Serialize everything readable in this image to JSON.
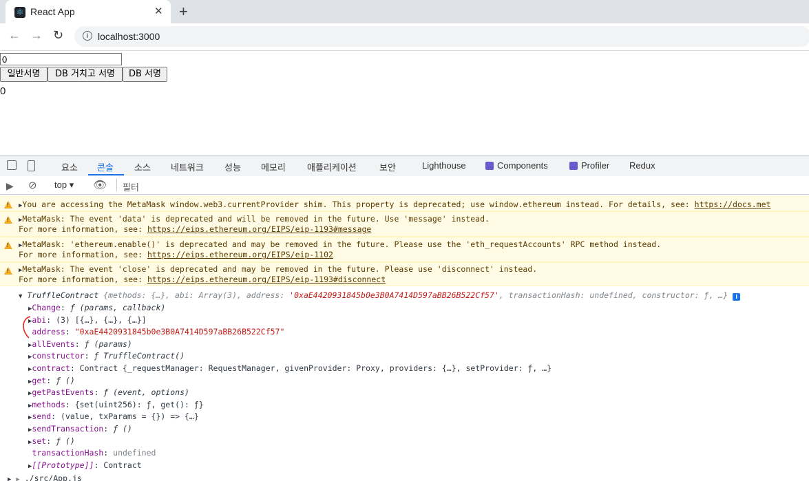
{
  "browser": {
    "tab_title": "React App",
    "url": "localhost:3000"
  },
  "page": {
    "input_value": "0",
    "buttons": [
      "일반서명",
      "DB 거치고 서명",
      "DB 서명"
    ],
    "output": "0"
  },
  "devtools": {
    "tabs": [
      "요소",
      "콘솔",
      "소스",
      "네트워크",
      "성능",
      "메모리",
      "애플리케이션",
      "보안",
      "Lighthouse",
      "Components",
      "Profiler",
      "Redux"
    ],
    "active_tab": "콘솔",
    "context": "top",
    "filter_placeholder": "필터"
  },
  "console": {
    "warnings": [
      {
        "text": "You are accessing the MetaMask window.web3.currentProvider shim. This property is deprecated; use window.ethereum instead. For details, see: ",
        "link": "https://docs.met"
      },
      {
        "text": "MetaMask: The event 'data' is deprecated and will be removed in the future. Use 'message' instead.",
        "more": "For more information, see: ",
        "link": "https://eips.ethereum.org/EIPS/eip-1193#message"
      },
      {
        "text": "MetaMask: 'ethereum.enable()' is deprecated and may be removed in the future. Please use the 'eth_requestAccounts' RPC method instead.",
        "more": "For more information, see: ",
        "link": "https://eips.ethereum.org/EIPS/eip-1102"
      },
      {
        "text": "MetaMask: The event 'close' is deprecated and may be removed in the future. Please use 'disconnect' instead.",
        "more": "For more information, see: ",
        "link": "https://eips.ethereum.org/EIPS/eip-1193#disconnect"
      }
    ],
    "object_header": {
      "name": "TruffleContract",
      "summary_a": " {methods: {…}, abi: Array(3), address: ",
      "address": "'0xaE4420931845b0e3B0A7414D597aBB26B522Cf57'",
      "summary_b": ", transactionHash: undefined, constructor: ƒ, …}"
    },
    "properties": [
      {
        "key": "Change",
        "value": "ƒ (params, callback)",
        "expandable": true
      },
      {
        "key": "abi",
        "value": "(3) [{…}, {…}, {…}]",
        "expandable": true
      },
      {
        "key": "address",
        "value": "\"0xaE4420931845b0e3B0A7414D597aBB26B522Cf57\"",
        "expandable": false
      },
      {
        "key": "allEvents",
        "value": "ƒ (params)",
        "expandable": true
      },
      {
        "key": "constructor",
        "value": "ƒ TruffleContract()",
        "expandable": true
      },
      {
        "key": "contract",
        "value": "Contract {_requestManager: RequestManager, givenProvider: Proxy, providers: {…}, setProvider: ƒ, …}",
        "expandable": true
      },
      {
        "key": "get",
        "value": "ƒ ()",
        "expandable": true
      },
      {
        "key": "getPastEvents",
        "value": "ƒ (event, options)",
        "expandable": true
      },
      {
        "key": "methods",
        "value": "{set(uint256): ƒ, get(): ƒ}",
        "expandable": true
      },
      {
        "key": "send",
        "value": "(value, txParams = {}) => {…}",
        "expandable": true
      },
      {
        "key": "sendTransaction",
        "value": "ƒ ()",
        "expandable": true
      },
      {
        "key": "set",
        "value": "ƒ ()",
        "expandable": true
      },
      {
        "key": "transactionHash",
        "value": "undefined",
        "expandable": false
      },
      {
        "key": "[[Prototype]]",
        "value": "Contract",
        "expandable": true
      }
    ],
    "source_line": "./src/App.js"
  }
}
